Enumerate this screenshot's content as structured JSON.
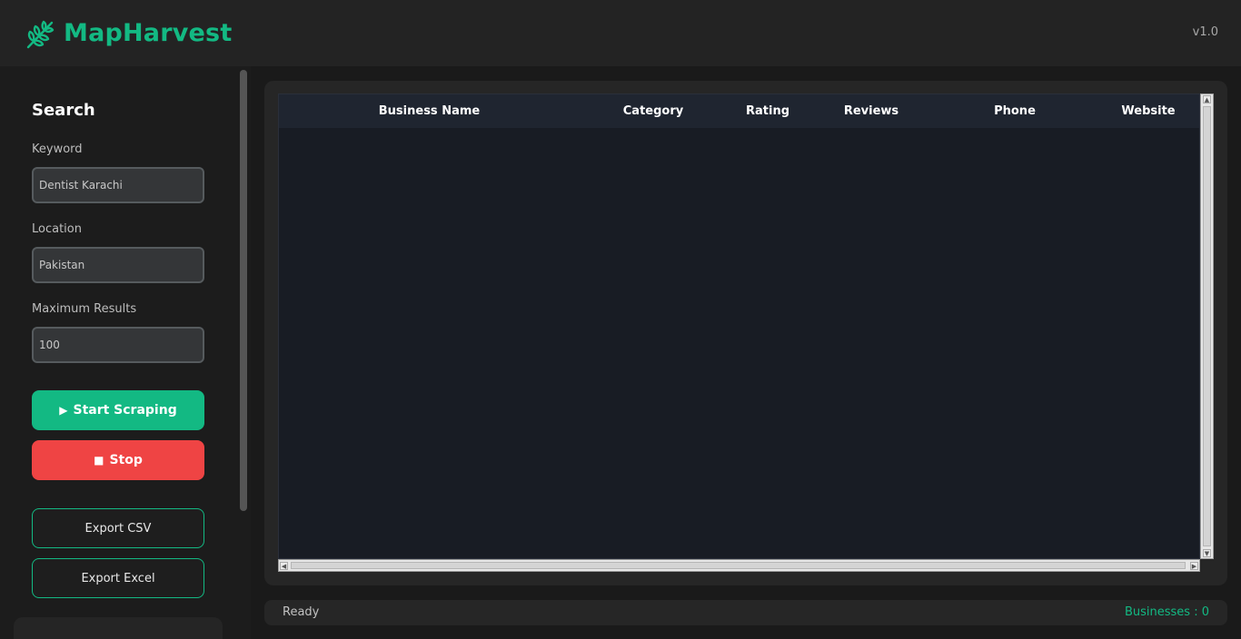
{
  "header": {
    "app_title": "MapHarvest",
    "version": "v1.0",
    "logo_icon": "wheat-icon",
    "accent_color": "#13b983"
  },
  "sidebar": {
    "section_title": "Search",
    "keyword": {
      "label": "Keyword",
      "value": "Dentist Karachi"
    },
    "location": {
      "label": "Location",
      "value": "Pakistan"
    },
    "max_results": {
      "label": "Maximum Results",
      "value": "100"
    },
    "start_button": {
      "label": "Start Scraping",
      "icon": "play-icon",
      "glyph": "▶",
      "color": "#13b983"
    },
    "stop_button": {
      "label": "Stop",
      "icon": "stop-icon",
      "glyph": "■",
      "color": "#ef4444"
    },
    "export_csv_button": {
      "label": "Export CSV"
    },
    "export_excel_button": {
      "label": "Export Excel"
    }
  },
  "table": {
    "columns": [
      "Business Name",
      "Category",
      "Rating",
      "Reviews",
      "Phone",
      "Website"
    ],
    "rows": []
  },
  "status_bar": {
    "status": "Ready",
    "count": "Businesses : 0"
  }
}
